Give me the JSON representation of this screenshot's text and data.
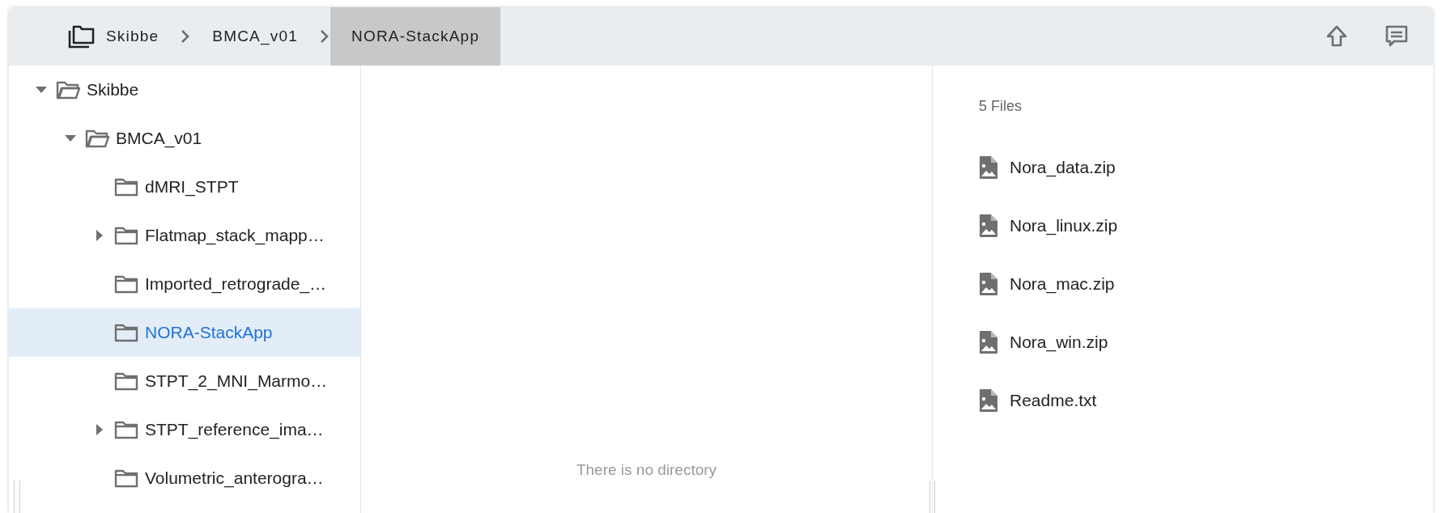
{
  "breadcrumb": [
    {
      "label": "Skibbe",
      "selected": false
    },
    {
      "label": "BMCA_v01",
      "selected": false
    },
    {
      "label": "NORA-StackApp",
      "selected": true
    }
  ],
  "tree": [
    {
      "label": "Skibbe",
      "kind": "branch",
      "expanded": true,
      "selected": false,
      "children": [
        {
          "label": "BMCA_v01",
          "kind": "branch",
          "expanded": true,
          "selected": false,
          "children": [
            {
              "label": "dMRI_STPT",
              "kind": "leaf",
              "selected": false
            },
            {
              "label": "Flatmap_stack_mapp…",
              "kind": "branch",
              "expanded": false,
              "selected": false
            },
            {
              "label": "Imported_retrograde_…",
              "kind": "leaf",
              "selected": false
            },
            {
              "label": "NORA-StackApp",
              "kind": "leaf",
              "selected": true
            },
            {
              "label": "STPT_2_MNI_Marmo…",
              "kind": "leaf",
              "selected": false
            },
            {
              "label": "STPT_reference_ima…",
              "kind": "branch",
              "expanded": false,
              "selected": false
            },
            {
              "label": "Volumetric_anterogra…",
              "kind": "leaf",
              "selected": false
            }
          ]
        }
      ]
    }
  ],
  "middle": {
    "empty_message": "There is no directory"
  },
  "files": {
    "count": "5 Files",
    "items": [
      {
        "name": "Nora_data.zip"
      },
      {
        "name": "Nora_linux.zip"
      },
      {
        "name": "Nora_mac.zip"
      },
      {
        "name": "Nora_win.zip"
      },
      {
        "name": "Readme.txt"
      }
    ]
  }
}
